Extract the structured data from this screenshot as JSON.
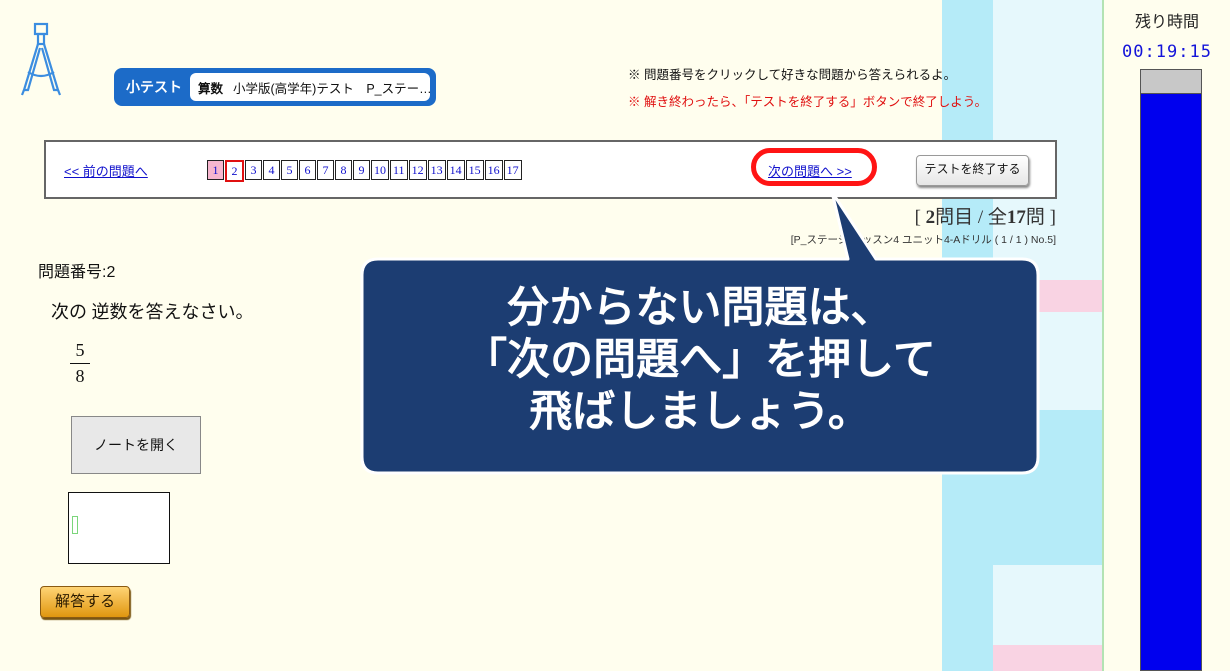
{
  "timer": {
    "label": "残り時間",
    "value": "00:19:15",
    "remaining_fraction": 0.96
  },
  "header": {
    "test_kind": "小テスト",
    "subject": "算数",
    "test_title": "小学版(高学年)テスト　P_ステー…",
    "note_click": "※ 問題番号をクリックして好きな問題から答えられるよ。",
    "note_finish": "※ 解き終わったら、「テストを終了する」ボタンで終了しよう。"
  },
  "nav": {
    "prev_label": "<< 前の問題へ",
    "next_label": "次の問題へ >>",
    "end_label": "テストを終了する",
    "question_numbers": [
      "1",
      "2",
      "3",
      "4",
      "5",
      "6",
      "7",
      "8",
      "9",
      "10",
      "11",
      "12",
      "13",
      "14",
      "15",
      "16",
      "17"
    ],
    "current_index": 1,
    "answered_indices": [
      0
    ]
  },
  "progress": {
    "open": "[ ",
    "current": "2",
    "mid": "問目 / 全",
    "total": "17",
    "close": "問 ]"
  },
  "drill_name": "[P_ステージ レッスン4 ユニット4-Aドリル ( 1 / 1 ) No.5]",
  "question": {
    "label": "問題番号:2",
    "text": "次の 逆数を答えなさい。",
    "numerator": "5",
    "denominator": "8"
  },
  "buttons": {
    "note": "ノートを開く",
    "answer": "解答する"
  },
  "callout": {
    "line1": "分からない問題は、",
    "line2": "「次の問題へ」を押して",
    "line3": "飛ばしましょう。",
    "fill": "#1c3d72",
    "border": "#ffffff"
  },
  "colors": {
    "accent_blue": "#1c6bc8",
    "link": "#1010cc",
    "highlight_red": "#ff1414",
    "timer_bar": "#0000ee"
  }
}
